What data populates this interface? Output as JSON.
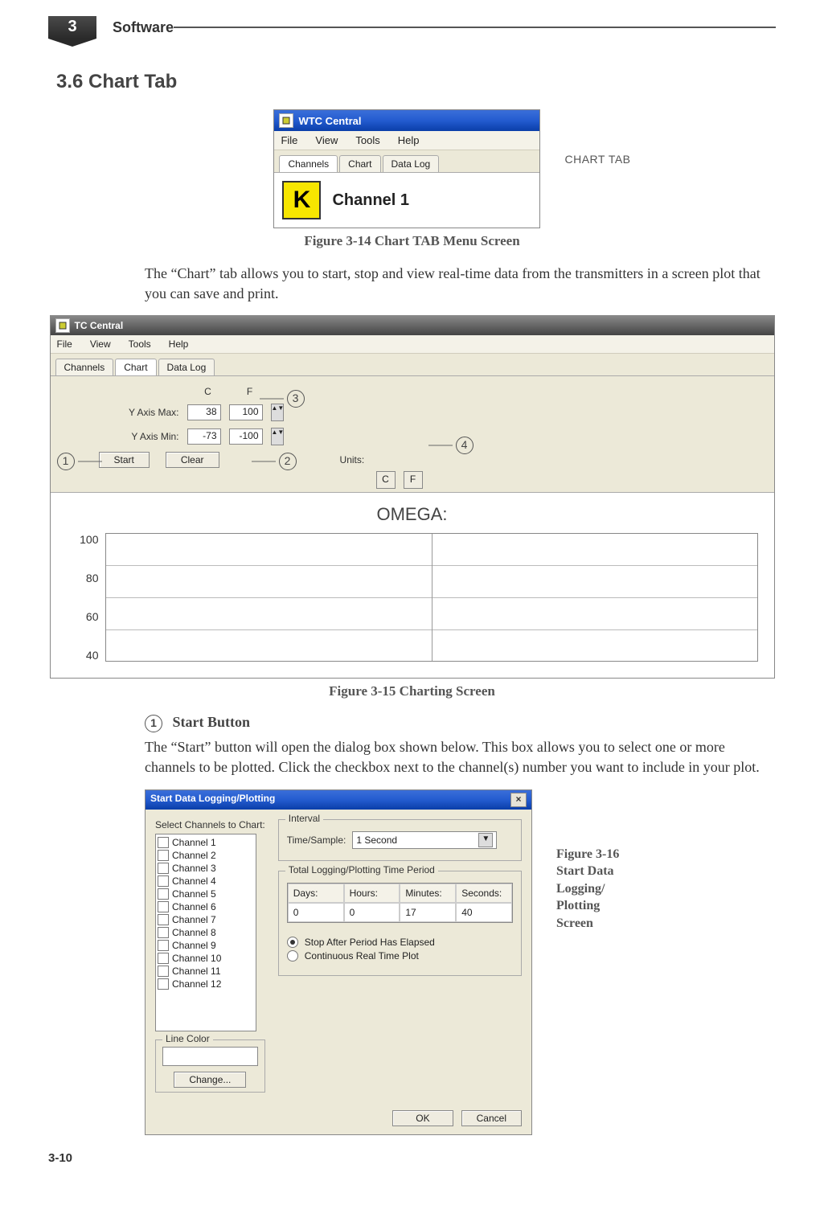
{
  "header": {
    "chapter_number": "3",
    "chapter_title": "Software"
  },
  "section_heading": "3.6 Chart Tab",
  "shot1": {
    "title": "WTC Central",
    "menu": [
      "File",
      "View",
      "Tools",
      "Help"
    ],
    "tabs": [
      "Channels",
      "Chart",
      "Data Log"
    ],
    "channel_box": "K",
    "channel_label": "Channel 1",
    "side_label": "CHART TAB"
  },
  "caption1": "Figure 3-14  Chart TAB Menu Screen",
  "para1": "The “Chart” tab allows you to start, stop and view real-time data from the transmitters in a screen plot that you can save and print.",
  "shot2": {
    "title": "TC Central",
    "menu": [
      "File",
      "View",
      "Tools",
      "Help"
    ],
    "tabs": [
      "Channels",
      "Chart",
      "Data Log"
    ],
    "col_c": "C",
    "col_f": "F",
    "yaxis_max_label": "Y Axis Max:",
    "yaxis_max_c": "38",
    "yaxis_max_f": "100",
    "yaxis_min_label": "Y Axis Min:",
    "yaxis_min_c": "-73",
    "yaxis_min_f": "-100",
    "start_btn": "Start",
    "clear_btn": "Clear",
    "units_label": "Units:",
    "unit_c": "C",
    "unit_f": "F",
    "chart_title": "OMEGA:",
    "yticks": [
      "100",
      "80",
      "60",
      "40"
    ],
    "ann1": "1",
    "ann2": "2",
    "ann3": "3",
    "ann4": "4"
  },
  "caption2": "Figure 3-15  Charting Screen",
  "sub_heading_num": "1",
  "sub_heading": "Start Button",
  "para2": "The “Start” button will open the dialog box shown below. This box allows you to select one or more channels to be plotted. Click the checkbox next to the channel(s) number you want to include in your plot.",
  "shot3": {
    "title": "Start Data Logging/Plotting",
    "select_label": "Select Channels to Chart:",
    "channels": [
      "Channel 1",
      "Channel 2",
      "Channel 3",
      "Channel 4",
      "Channel 5",
      "Channel 6",
      "Channel 7",
      "Channel 8",
      "Channel 9",
      "Channel 10",
      "Channel 11",
      "Channel 12"
    ],
    "linecolor_label": "Line Color",
    "change_btn": "Change...",
    "interval_label": "Interval",
    "time_sample_label": "Time/Sample:",
    "time_sample_value": "1 Second",
    "period_label": "Total Logging/Plotting Time Period",
    "cols": [
      "Days:",
      "Hours:",
      "Minutes:",
      "Seconds:"
    ],
    "vals": [
      "0",
      "0",
      "17",
      "40"
    ],
    "radio1": "Stop After Period Has Elapsed",
    "radio2": "Continuous Real Time Plot",
    "ok": "OK",
    "cancel": "Cancel"
  },
  "caption3": "Figure 3-16\nStart Data\nLogging/\nPlotting\nScreen",
  "page_number": "3-10"
}
